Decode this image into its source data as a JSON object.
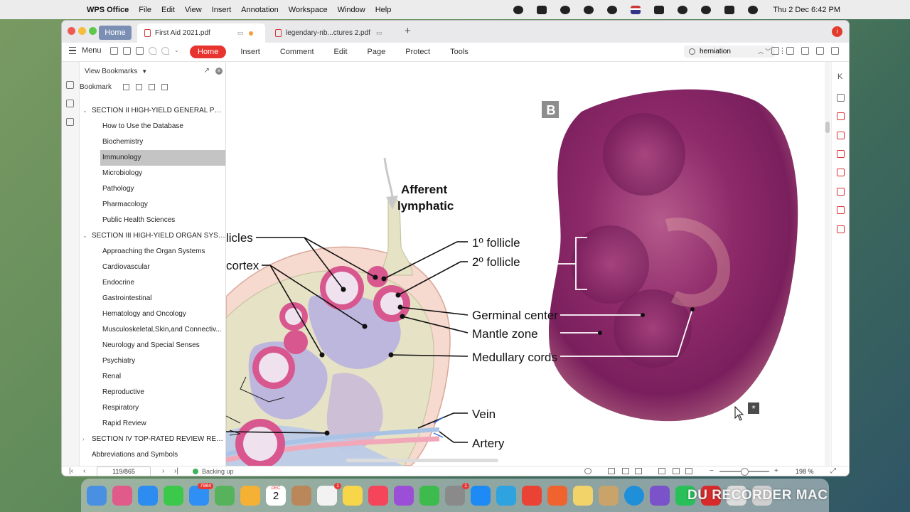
{
  "menubar": {
    "app": "WPS Office",
    "items": [
      "File",
      "Edit",
      "View",
      "Insert",
      "Annotation",
      "Workspace",
      "Window",
      "Help"
    ],
    "clock": "Thu 2 Dec  6:42 PM"
  },
  "tabs": {
    "home": "Home",
    "doc1": "First Aid 2021.pdf",
    "doc2": "legendary-nb...ctures 2.pdf"
  },
  "toolbar": {
    "menu_label": "Menu",
    "ribbon": [
      "Home",
      "Insert",
      "Comment",
      "Edit",
      "Page",
      "Protect",
      "Tools"
    ],
    "search_value": "herniation"
  },
  "sidebar": {
    "header": "View Bookmarks",
    "sub_label": "Bookmark",
    "items": [
      {
        "label": "SECTION II HIGH-YIELD GENERAL PRIN...",
        "level": 1,
        "twist": "⌄"
      },
      {
        "label": "How to Use the Database",
        "level": 2
      },
      {
        "label": "Biochemistry",
        "level": 2
      },
      {
        "label": "Immunology",
        "level": 2,
        "selected": true
      },
      {
        "label": "Microbiology",
        "level": 2
      },
      {
        "label": "Pathology",
        "level": 2
      },
      {
        "label": "Pharmacology",
        "level": 2
      },
      {
        "label": "Public Health Sciences",
        "level": 2
      },
      {
        "label": "SECTION III HIGH-YIELD ORGAN SYSTE...",
        "level": 1,
        "twist": "⌄"
      },
      {
        "label": "Approaching the Organ Systems",
        "level": 2
      },
      {
        "label": "Cardiovascular",
        "level": 2
      },
      {
        "label": "Endocrine",
        "level": 2
      },
      {
        "label": "Gastrointestinal",
        "level": 2
      },
      {
        "label": "Hematology and Oncology",
        "level": 2
      },
      {
        "label": "Musculoskeletal,Skin,and Connectiv...",
        "level": 2
      },
      {
        "label": "Neurology and Special Senses",
        "level": 2
      },
      {
        "label": "Psychiatry",
        "level": 2
      },
      {
        "label": "Renal",
        "level": 2
      },
      {
        "label": "Reproductive",
        "level": 2
      },
      {
        "label": "Respiratory",
        "level": 2
      },
      {
        "label": "Rapid Review",
        "level": 2
      },
      {
        "label": "SECTION IV TOP-RATED REVIEW RESO...",
        "level": 1,
        "twist": "›"
      },
      {
        "label": "Abbreviations and Symbols",
        "level": 1
      }
    ]
  },
  "figure": {
    "panel_letter": "B",
    "labels": {
      "afferent_1": "Afferent",
      "afferent_2": "lymphatic",
      "follicles": "licles",
      "cortex": "cortex",
      "follicle1": "1º follicle",
      "follicle2": "2º follicle",
      "germinal": "Germinal center",
      "mantle": "Mantle zone",
      "medullary": "Medullary cords",
      "vein": "Vein",
      "artery": "Artery"
    }
  },
  "status": {
    "page": "119/865",
    "backing": "Backing up",
    "zoom": "198 %"
  },
  "dock": {
    "mail_badge": "7984",
    "reminders_badge": "1",
    "settings_badge": "1",
    "cal_month": "DEC",
    "cal_day": "2",
    "watermark": "DU RECORDER MAC"
  },
  "colors": {
    "accent": "#e8342f",
    "tissue": "#8e2a6a",
    "follicle_pink": "#d8578f"
  }
}
